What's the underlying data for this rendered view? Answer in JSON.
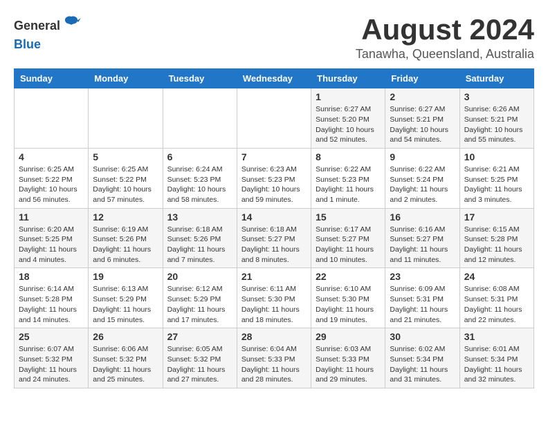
{
  "header": {
    "logo": {
      "general": "General",
      "blue": "Blue"
    },
    "month": "August 2024",
    "location": "Tanawha, Queensland, Australia"
  },
  "weekdays": [
    "Sunday",
    "Monday",
    "Tuesday",
    "Wednesday",
    "Thursday",
    "Friday",
    "Saturday"
  ],
  "weeks": [
    [
      {
        "day": "",
        "sunrise": "",
        "sunset": "",
        "daylight": ""
      },
      {
        "day": "",
        "sunrise": "",
        "sunset": "",
        "daylight": ""
      },
      {
        "day": "",
        "sunrise": "",
        "sunset": "",
        "daylight": ""
      },
      {
        "day": "",
        "sunrise": "",
        "sunset": "",
        "daylight": ""
      },
      {
        "day": "1",
        "sunrise": "6:27 AM",
        "sunset": "5:20 PM",
        "daylight": "10 hours and 52 minutes."
      },
      {
        "day": "2",
        "sunrise": "6:27 AM",
        "sunset": "5:21 PM",
        "daylight": "10 hours and 54 minutes."
      },
      {
        "day": "3",
        "sunrise": "6:26 AM",
        "sunset": "5:21 PM",
        "daylight": "10 hours and 55 minutes."
      }
    ],
    [
      {
        "day": "4",
        "sunrise": "6:25 AM",
        "sunset": "5:22 PM",
        "daylight": "10 hours and 56 minutes."
      },
      {
        "day": "5",
        "sunrise": "6:25 AM",
        "sunset": "5:22 PM",
        "daylight": "10 hours and 57 minutes."
      },
      {
        "day": "6",
        "sunrise": "6:24 AM",
        "sunset": "5:23 PM",
        "daylight": "10 hours and 58 minutes."
      },
      {
        "day": "7",
        "sunrise": "6:23 AM",
        "sunset": "5:23 PM",
        "daylight": "10 hours and 59 minutes."
      },
      {
        "day": "8",
        "sunrise": "6:22 AM",
        "sunset": "5:23 PM",
        "daylight": "11 hours and 1 minute."
      },
      {
        "day": "9",
        "sunrise": "6:22 AM",
        "sunset": "5:24 PM",
        "daylight": "11 hours and 2 minutes."
      },
      {
        "day": "10",
        "sunrise": "6:21 AM",
        "sunset": "5:25 PM",
        "daylight": "11 hours and 3 minutes."
      }
    ],
    [
      {
        "day": "11",
        "sunrise": "6:20 AM",
        "sunset": "5:25 PM",
        "daylight": "11 hours and 4 minutes."
      },
      {
        "day": "12",
        "sunrise": "6:19 AM",
        "sunset": "5:26 PM",
        "daylight": "11 hours and 6 minutes."
      },
      {
        "day": "13",
        "sunrise": "6:18 AM",
        "sunset": "5:26 PM",
        "daylight": "11 hours and 7 minutes."
      },
      {
        "day": "14",
        "sunrise": "6:18 AM",
        "sunset": "5:27 PM",
        "daylight": "11 hours and 8 minutes."
      },
      {
        "day": "15",
        "sunrise": "6:17 AM",
        "sunset": "5:27 PM",
        "daylight": "11 hours and 10 minutes."
      },
      {
        "day": "16",
        "sunrise": "6:16 AM",
        "sunset": "5:27 PM",
        "daylight": "11 hours and 11 minutes."
      },
      {
        "day": "17",
        "sunrise": "6:15 AM",
        "sunset": "5:28 PM",
        "daylight": "11 hours and 12 minutes."
      }
    ],
    [
      {
        "day": "18",
        "sunrise": "6:14 AM",
        "sunset": "5:28 PM",
        "daylight": "11 hours and 14 minutes."
      },
      {
        "day": "19",
        "sunrise": "6:13 AM",
        "sunset": "5:29 PM",
        "daylight": "11 hours and 15 minutes."
      },
      {
        "day": "20",
        "sunrise": "6:12 AM",
        "sunset": "5:29 PM",
        "daylight": "11 hours and 17 minutes."
      },
      {
        "day": "21",
        "sunrise": "6:11 AM",
        "sunset": "5:30 PM",
        "daylight": "11 hours and 18 minutes."
      },
      {
        "day": "22",
        "sunrise": "6:10 AM",
        "sunset": "5:30 PM",
        "daylight": "11 hours and 19 minutes."
      },
      {
        "day": "23",
        "sunrise": "6:09 AM",
        "sunset": "5:31 PM",
        "daylight": "11 hours and 21 minutes."
      },
      {
        "day": "24",
        "sunrise": "6:08 AM",
        "sunset": "5:31 PM",
        "daylight": "11 hours and 22 minutes."
      }
    ],
    [
      {
        "day": "25",
        "sunrise": "6:07 AM",
        "sunset": "5:32 PM",
        "daylight": "11 hours and 24 minutes."
      },
      {
        "day": "26",
        "sunrise": "6:06 AM",
        "sunset": "5:32 PM",
        "daylight": "11 hours and 25 minutes."
      },
      {
        "day": "27",
        "sunrise": "6:05 AM",
        "sunset": "5:32 PM",
        "daylight": "11 hours and 27 minutes."
      },
      {
        "day": "28",
        "sunrise": "6:04 AM",
        "sunset": "5:33 PM",
        "daylight": "11 hours and 28 minutes."
      },
      {
        "day": "29",
        "sunrise": "6:03 AM",
        "sunset": "5:33 PM",
        "daylight": "11 hours and 29 minutes."
      },
      {
        "day": "30",
        "sunrise": "6:02 AM",
        "sunset": "5:34 PM",
        "daylight": "11 hours and 31 minutes."
      },
      {
        "day": "31",
        "sunrise": "6:01 AM",
        "sunset": "5:34 PM",
        "daylight": "11 hours and 32 minutes."
      }
    ]
  ],
  "labels": {
    "sunrise_prefix": "Sunrise: ",
    "sunset_prefix": "Sunset: ",
    "daylight_prefix": "Daylight: "
  }
}
